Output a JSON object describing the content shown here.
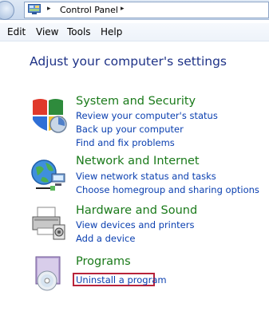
{
  "address_bar": {
    "breadcrumb": "Control Panel",
    "separator": "▸"
  },
  "menu": [
    "Edit",
    "View",
    "Tools",
    "Help"
  ],
  "heading": "Adjust your computer's settings",
  "categories": [
    {
      "title": "System and Security",
      "icon": "shield-icon",
      "links": [
        "Review your computer's status",
        "Back up your computer",
        "Find and fix problems"
      ]
    },
    {
      "title": "Network and Internet",
      "icon": "network-globe-icon",
      "links": [
        "View network status and tasks",
        "Choose homegroup and sharing options"
      ]
    },
    {
      "title": "Hardware and Sound",
      "icon": "printer-icon",
      "links": [
        "View devices and printers",
        "Add a device"
      ]
    },
    {
      "title": "Programs",
      "icon": "programs-disc-icon",
      "links": [
        "Uninstall a program"
      ]
    }
  ],
  "colors": {
    "heading": "#1e3287",
    "category_title": "#1a7a1a",
    "link": "#0a3fb0",
    "highlight_border": "#b8233a"
  }
}
